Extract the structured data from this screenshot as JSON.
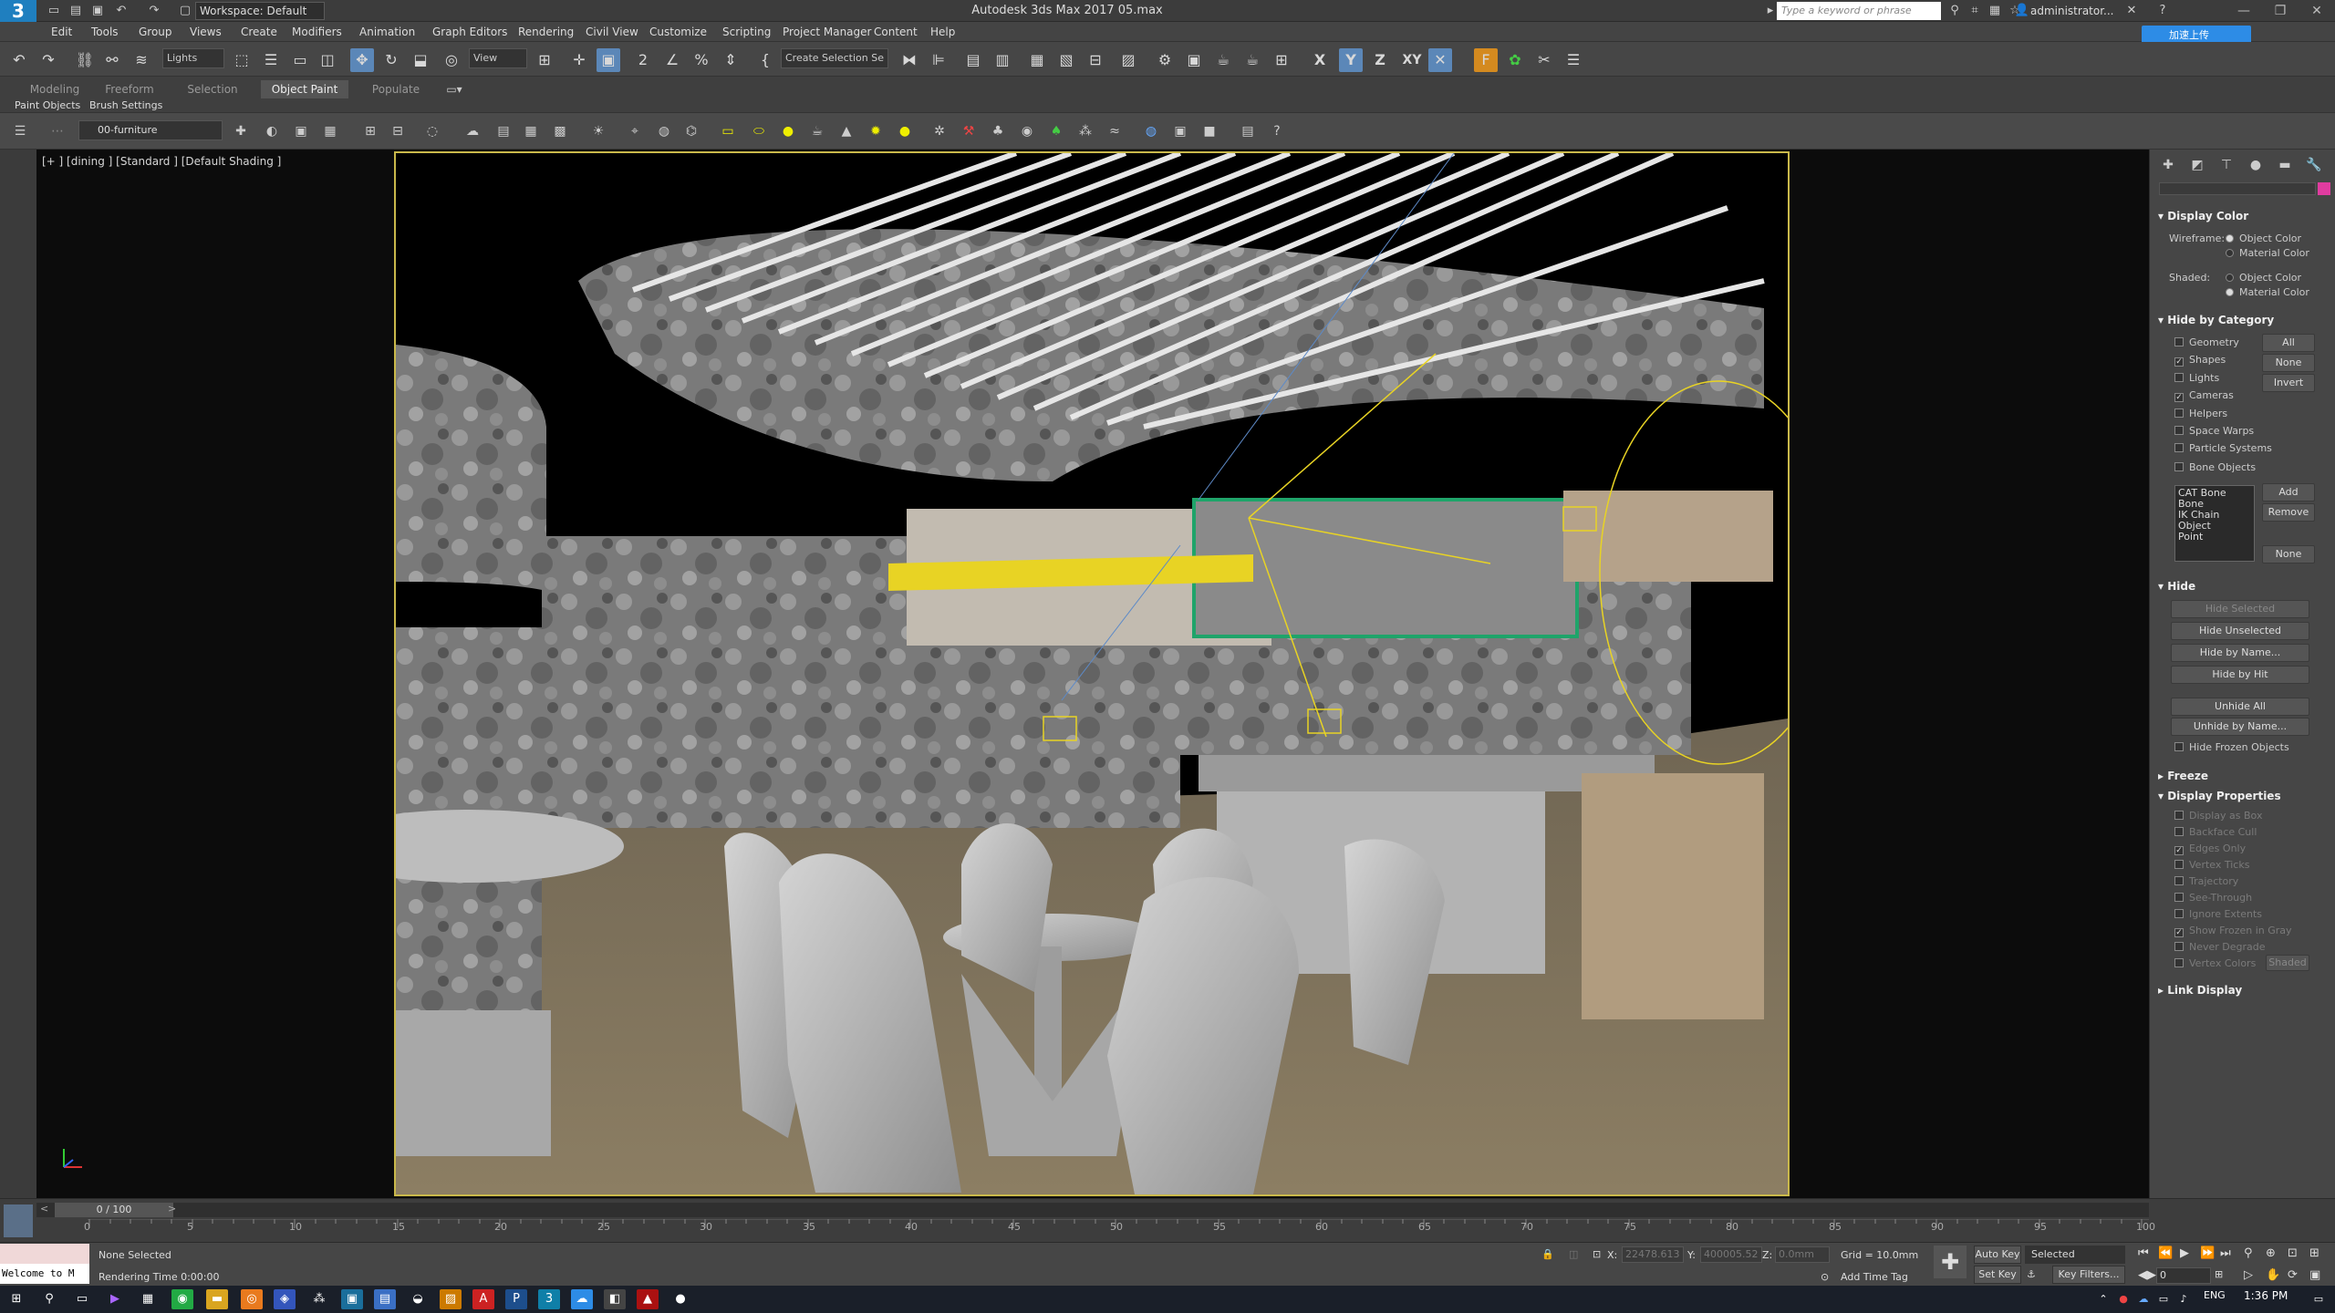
{
  "titlebar": {
    "workspace": "Workspace: Default",
    "title": "Autodesk 3ds Max 2017    05.max",
    "search_placeholder": "Type a keyword or phrase",
    "user": "administrator..."
  },
  "menu": [
    "Edit",
    "Tools",
    "Group",
    "Views",
    "Create",
    "Modifiers",
    "Animation",
    "Graph Editors",
    "Rendering",
    "Civil View",
    "Customize",
    "Scripting",
    "Project Manager",
    "Content",
    "Help"
  ],
  "upload_label": "加速上传",
  "toolbar": {
    "filter": "Lights",
    "ref_coord": "View",
    "selection_set": "Create Selection Se",
    "axis_x": "X",
    "axis_y": "Y",
    "axis_z": "Z",
    "axis_xy": "XY"
  },
  "ribbon": {
    "tabs": [
      "Modeling",
      "Freeform",
      "Selection",
      "Object Paint",
      "Populate"
    ],
    "active_tab": "Object Paint",
    "subs": [
      "Paint Objects",
      "Brush Settings"
    ]
  },
  "scene": {
    "layer": "00-furniture"
  },
  "viewport": {
    "label": "[+ ] [dining ] [Standard ] [Default Shading ]"
  },
  "command_panel": {
    "display_color": {
      "title": "Display Color",
      "wireframe_label": "Wireframe:",
      "shaded_label": "Shaded:",
      "object_color": "Object Color",
      "material_color": "Material Color"
    },
    "hide_by_category": {
      "title": "Hide by Category",
      "items": [
        {
          "label": "Geometry",
          "checked": false
        },
        {
          "label": "Shapes",
          "checked": true
        },
        {
          "label": "Lights",
          "checked": false
        },
        {
          "label": "Cameras",
          "checked": true
        },
        {
          "label": "Helpers",
          "checked": false
        },
        {
          "label": "Space Warps",
          "checked": false
        },
        {
          "label": "Particle Systems",
          "checked": false
        },
        {
          "label": "Bone Objects",
          "checked": false
        }
      ],
      "btn_all": "All",
      "btn_none": "None",
      "btn_invert": "Invert",
      "list": [
        "CAT Bone",
        "Bone",
        "IK Chain Object",
        "Point"
      ],
      "btn_add": "Add",
      "btn_remove": "Remove",
      "btn_none2": "None"
    },
    "hide": {
      "title": "Hide",
      "hide_selected": "Hide Selected",
      "hide_unselected": "Hide Unselected",
      "hide_by_name": "Hide by Name...",
      "hide_by_hit": "Hide by Hit",
      "unhide_all": "Unhide All",
      "unhide_by_name": "Unhide by Name...",
      "hide_frozen": "Hide Frozen Objects"
    },
    "freeze": {
      "title": "Freeze"
    },
    "display_properties": {
      "title": "Display Properties",
      "items": [
        "Display as Box",
        "Backface Cull",
        "Edges Only",
        "Vertex Ticks",
        "Trajectory",
        "See-Through",
        "Ignore Extents",
        "Show Frozen in Gray",
        "Never Degrade",
        "Vertex Colors"
      ],
      "shaded_btn": "Shaded"
    },
    "link_display": {
      "title": "Link Display"
    }
  },
  "timeline": {
    "frame": "0 / 100",
    "ticks": [
      "0",
      "5",
      "10",
      "15",
      "20",
      "25",
      "30",
      "35",
      "40",
      "45",
      "50",
      "55",
      "60",
      "65",
      "70",
      "75",
      "80",
      "85",
      "90",
      "95",
      "100"
    ]
  },
  "status": {
    "maxscript": "",
    "welcome": "Welcome to M",
    "selection": "None Selected",
    "render_time": "Rendering Time  0:00:00",
    "x_label": "X:",
    "x_val": "22478.613",
    "y_label": "Y:",
    "y_val": "400005.52",
    "z_label": "Z:",
    "z_val": "0.0mm",
    "grid": "Grid = 10.0mm",
    "add_time_tag": "Add Time Tag",
    "auto_key": "Auto Key",
    "set_key": "Set Key",
    "selected": "Selected",
    "key_filters": "Key Filters...",
    "frame_num": "0"
  },
  "taskbar": {
    "lang": "ENG",
    "time": "1:36 PM"
  }
}
